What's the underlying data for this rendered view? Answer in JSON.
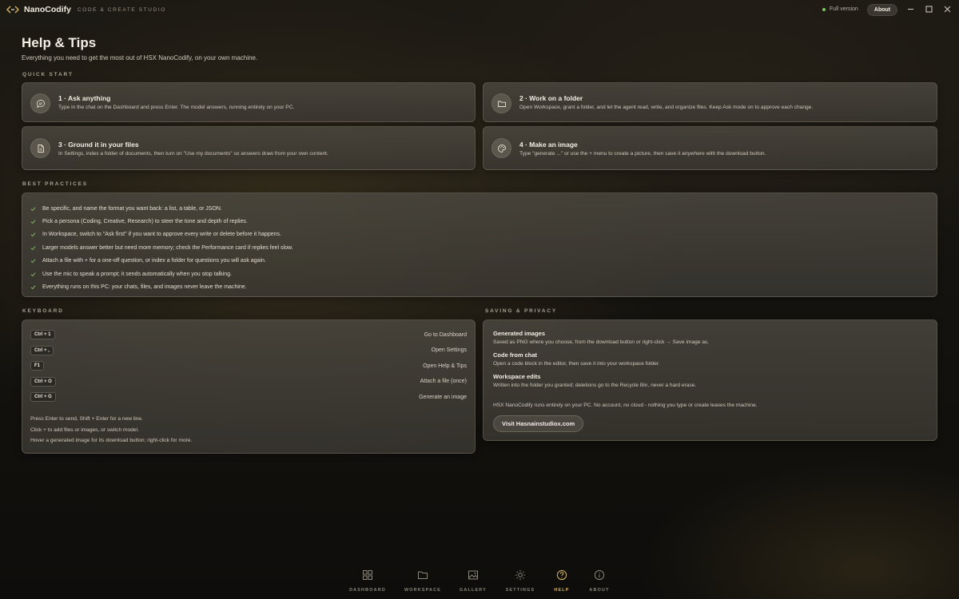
{
  "app": {
    "name": "NanoCodify",
    "tagline": "CODE & CREATE STUDIO",
    "status": "Full version",
    "about_label": "About"
  },
  "page": {
    "title": "Help & Tips",
    "subtitle": "Everything you need to get the most out of HSX NanoCodify, on your own machine."
  },
  "quick_start": {
    "label": "QUICK START",
    "cards": [
      {
        "icon": "chat-bubble-icon",
        "title": "1 · Ask anything",
        "desc": "Type in the chat on the Dashboard and press Enter. The model answers, running entirely on your PC."
      },
      {
        "icon": "folder-icon",
        "title": "2 · Work on a folder",
        "desc": "Open Workspace, grant a folder, and let the agent read, write, and organize files. Keep Ask mode on to approve each change."
      },
      {
        "icon": "document-icon",
        "title": "3 · Ground it in your files",
        "desc": "In Settings, index a folder of documents, then turn on \"Use my documents\" so answers draw from your own content."
      },
      {
        "icon": "palette-icon",
        "title": "4 · Make an image",
        "desc": "Type \"generate ...\" or use the + menu to create a picture, then save it anywhere with the download button."
      }
    ]
  },
  "best_practices": {
    "label": "BEST PRACTICES",
    "items": [
      "Be specific, and name the format you want back: a list, a table, or JSON.",
      "Pick a persona (Coding, Creative, Research) to steer the tone and depth of replies.",
      "In Workspace, switch to \"Ask first\" if you want to approve every write or delete before it happens.",
      "Larger models answer better but need more memory; check the Performance card if replies feel slow.",
      "Attach a file with + for a one-off question, or index a folder for questions you will ask again.",
      "Use the mic to speak a prompt; it sends automatically when you stop talking.",
      "Everything runs on this PC: your chats, files, and images never leave the machine."
    ]
  },
  "keyboard": {
    "label": "KEYBOARD",
    "shortcuts": [
      {
        "key": "Ctrl + 1",
        "action": "Go to Dashboard"
      },
      {
        "key": "Ctrl + ,",
        "action": "Open Settings"
      },
      {
        "key": "F1",
        "action": "Open Help & Tips"
      },
      {
        "key": "Ctrl + O",
        "action": "Attach a file (once)"
      },
      {
        "key": "Ctrl + G",
        "action": "Generate an image"
      }
    ],
    "notes": [
      "Press Enter to send, Shift + Enter for a new line.",
      "Click + to add files or images, or switch model.",
      "Hover a generated image for its download button; right-click for more."
    ]
  },
  "privacy": {
    "label": "SAVING & PRIVACY",
    "sections": [
      {
        "title": "Generated images",
        "text": "Saved as PNG where you choose, from the download button or right-click → Save image as."
      },
      {
        "title": "Code from chat",
        "text": "Open a code block in the editor, then save it into your workspace folder."
      },
      {
        "title": "Workspace edits",
        "text": "Written into the folder you granted; deletions go to the Recycle Bin, never a hard erase."
      }
    ],
    "footer": "HSX NanoCodify runs entirely on your PC. No account, no cloud - nothing you type or create leaves the machine.",
    "button": "Visit Hasnainstudiox.com"
  },
  "nav": [
    {
      "label": "DASHBOARD",
      "icon": "grid-icon",
      "active": false
    },
    {
      "label": "WORKSPACE",
      "icon": "folder-icon",
      "active": false
    },
    {
      "label": "GALLERY",
      "icon": "image-icon",
      "active": false
    },
    {
      "label": "SETTINGS",
      "icon": "sun-gear-icon",
      "active": false
    },
    {
      "label": "HELP",
      "icon": "help-icon",
      "active": true
    },
    {
      "label": "ABOUT",
      "icon": "info-icon",
      "active": false
    }
  ],
  "colors": {
    "accent": "#d9b865",
    "status_green": "#7ec85a",
    "check_green": "#7fb95a"
  }
}
